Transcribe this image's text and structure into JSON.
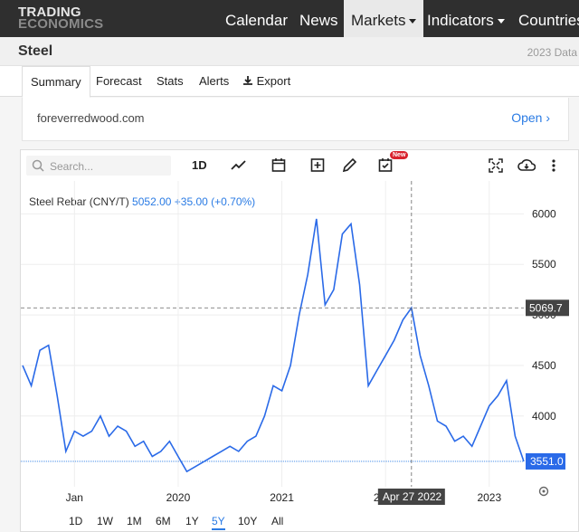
{
  "topnav": {
    "logo_line1": "TRADING",
    "logo_line2": "ECONOMICS",
    "items": [
      "Calendar",
      "News",
      "Markets",
      "Indicators",
      "Countries"
    ],
    "active": "Markets"
  },
  "titlebar": {
    "title": "Steel",
    "year": "2023 Data"
  },
  "tabs": [
    "Summary",
    "Forecast",
    "Stats",
    "Alerts",
    "Export"
  ],
  "ad": {
    "url": "foreverredwood.com",
    "cta": "Open"
  },
  "toolbar": {
    "search_placeholder": "Search...",
    "interval": "1D",
    "icons": [
      "line-chart-icon",
      "calendar-icon",
      "plus-box-icon",
      "pencil-icon",
      "calendar-check-icon",
      "fullscreen-icon",
      "download-cloud-icon",
      "more-vertical-icon"
    ],
    "new_badge": "New"
  },
  "legend": {
    "name": "Steel Rebar (CNY/T)",
    "price": "5052.00",
    "change": "+35.00 (+0.70%)"
  },
  "ranges": [
    "1D",
    "1W",
    "1M",
    "6M",
    "1Y",
    "5Y",
    "10Y",
    "All"
  ],
  "active_range": "5Y",
  "crosshair": {
    "price_label": "5069.7",
    "date_label": "Apr 27 2022"
  },
  "last_price_label": "3551.0",
  "colors": {
    "line": "#2a6ae8",
    "accent": "#2a7be4",
    "axis_label_bg": "#444444"
  },
  "chart_data": {
    "type": "line",
    "title": "Steel Rebar (CNY/T)",
    "xlabel": "",
    "ylabel": "",
    "x_ticks": [
      "Jan",
      "2020",
      "2021",
      "2022",
      "2023"
    ],
    "y_ticks": [
      4000,
      4500,
      5000,
      5500,
      6000
    ],
    "ylim": [
      3300,
      6200
    ],
    "grid": true,
    "series": [
      {
        "name": "Steel Rebar (CNY/T)",
        "x": [
          "2018-07",
          "2018-08",
          "2018-09",
          "2018-10",
          "2018-11",
          "2018-12",
          "2019-01",
          "2019-02",
          "2019-03",
          "2019-04",
          "2019-05",
          "2019-06",
          "2019-07",
          "2019-08",
          "2019-09",
          "2019-10",
          "2019-11",
          "2019-12",
          "2020-01",
          "2020-02",
          "2020-03",
          "2020-04",
          "2020-05",
          "2020-06",
          "2020-07",
          "2020-08",
          "2020-09",
          "2020-10",
          "2020-11",
          "2020-12",
          "2021-01",
          "2021-02",
          "2021-03",
          "2021-04",
          "2021-05",
          "2021-06",
          "2021-07",
          "2021-08",
          "2021-09",
          "2021-10",
          "2021-11",
          "2021-12",
          "2022-01",
          "2022-02",
          "2022-03",
          "2022-04",
          "2022-05",
          "2022-06",
          "2022-07",
          "2022-08",
          "2022-09",
          "2022-10",
          "2022-11",
          "2022-12",
          "2023-01",
          "2023-02",
          "2023-03",
          "2023-04",
          "2023-05"
        ],
        "values": [
          4500,
          4300,
          4650,
          4700,
          4200,
          3650,
          3850,
          3800,
          3850,
          4000,
          3800,
          3900,
          3850,
          3700,
          3750,
          3600,
          3650,
          3750,
          3600,
          3450,
          3500,
          3550,
          3600,
          3650,
          3700,
          3650,
          3750,
          3800,
          4000,
          4300,
          4250,
          4500,
          5000,
          5400,
          5950,
          5100,
          5250,
          5800,
          5900,
          5300,
          4300,
          4450,
          4600,
          4750,
          4950,
          5069.7,
          4600,
          4300,
          3950,
          3900,
          3750,
          3800,
          3700,
          3900,
          4100,
          4200,
          4350,
          3800,
          3551
        ]
      }
    ]
  }
}
